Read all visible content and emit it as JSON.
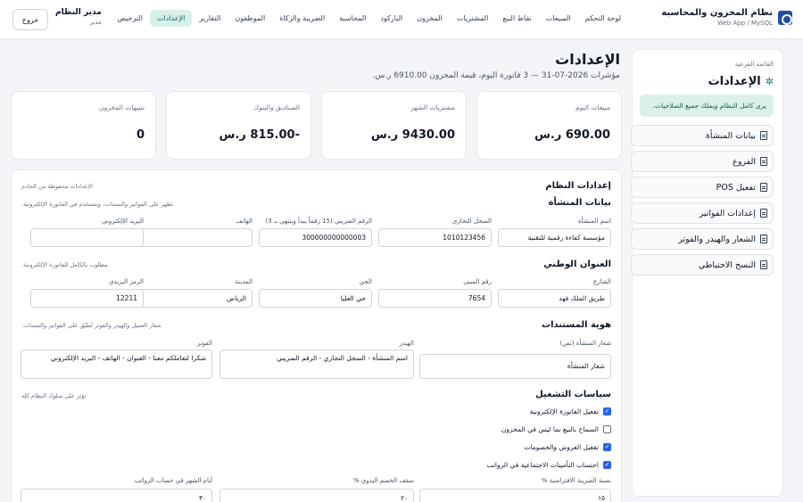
{
  "header": {
    "brand_title": "نظام المخزون والمحاسبة",
    "brand_sub": "Web App / MySQL",
    "nav": [
      "لوحة التحكم",
      "المبيعات",
      "نقاط البيع",
      "المشتريات",
      "المخزون",
      "الباركود",
      "المحاسبة",
      "الضريبة والزكاة",
      "الموظفون",
      "التقارير",
      "الإعدادات",
      "الترخيص"
    ],
    "active_nav": "الإعدادات",
    "user_name": "مدير النظام",
    "user_role": "مدير",
    "logout_label": "خروج"
  },
  "side": {
    "label": "القائمة الفرعية",
    "title": "الإعدادات",
    "note": "يرى كامل النظام ويملك جميع الصلاحيات.",
    "items": [
      "بيانات المنشأة",
      "الفروع",
      "تفعيل POS",
      "إعدادات الفواتير",
      "الشعار والهيدر والفوتر",
      "النسخ الاحتياطي"
    ]
  },
  "page": {
    "title": "الإعدادات",
    "subtitle": "مؤشرات 2026-07-31 — 3 فاتورة اليوم، قيمة المخزون 6910.00 ر.س."
  },
  "cards": [
    {
      "label": "مبيعات اليوم",
      "value": "690.00 ر.س"
    },
    {
      "label": "مشتريات الشهر",
      "value": "9430.00 ر.س"
    },
    {
      "label": "الصناديق والبنوك",
      "value": "-815.00 ر.س"
    },
    {
      "label": "تنبيهات المخزون",
      "value": "0"
    }
  ],
  "settings": {
    "title": "إعدادات النظام",
    "note": "الإعدادات محفوظة من الخادم",
    "company": {
      "title": "بيانات المنشأة",
      "hint": "تظهر على الفواتير والسندات، وتستخدم في الفاتورة الإلكترونية.",
      "fields": [
        {
          "label": "اسم المنشأة",
          "value": "مؤسسة كفاءة رقمية للتقنية"
        },
        {
          "label": "السجل التجاري",
          "value": "1010123456"
        },
        {
          "label": "الرقم الضريبي (15 رقماً يبدأ وينتهي بـ 3)",
          "value": "300000000000003"
        },
        {
          "label": "الهاتف",
          "value": ""
        },
        {
          "label": "البريد الإلكتروني",
          "value": ""
        }
      ]
    },
    "address": {
      "title": "العنوان الوطني",
      "hint": "مطلوب بالكامل للفاتورة الإلكترونية.",
      "fields": [
        {
          "label": "الشارع",
          "value": "طريق الملك فهد"
        },
        {
          "label": "رقم المبنى",
          "value": "7654"
        },
        {
          "label": "الحي",
          "value": "حي العليا"
        },
        {
          "label": "المدينة",
          "value": "الرياض"
        },
        {
          "label": "الرمز البريدي",
          "value": "12211"
        }
      ]
    },
    "identity": {
      "title": "هوية المستندات",
      "hint": "شعار العميل والهيدر والفوتر تُطبّق على الفواتير والسندات.",
      "logo_label": "شعار المنشأة (نص)",
      "logo_value": "شعار المنشأة",
      "header_label": "الهيدر",
      "header_value": "اسم المنشأة - السجل التجاري - الرقم الضريبي",
      "footer_label": "الفوتر",
      "footer_value": "شكرا لتعاملكم معنا - العنوان - الهاتف - البريد الإلكتروني"
    },
    "policies": {
      "title": "سياسات التشغيل",
      "hint": "تؤثر على سلوك النظام كله",
      "checks": [
        {
          "label": "تفعيل الفاتورة الإلكترونية",
          "checked": true
        },
        {
          "label": "السماح بالبيع بما ليس في المخزون",
          "checked": false
        },
        {
          "label": "تفعيل العروض والخصومات",
          "checked": true
        },
        {
          "label": "احتساب التأمينات الاجتماعية في الرواتب",
          "checked": true
        }
      ],
      "fields": [
        {
          "label": "نسبة الضريبة الافتراضية %",
          "value": "١٥"
        },
        {
          "label": "سقف الخصم اليدوي %",
          "value": "٢٠"
        },
        {
          "label": "أيام الشهر في حساب الرواتب",
          "value": "٣٠"
        }
      ]
    }
  }
}
